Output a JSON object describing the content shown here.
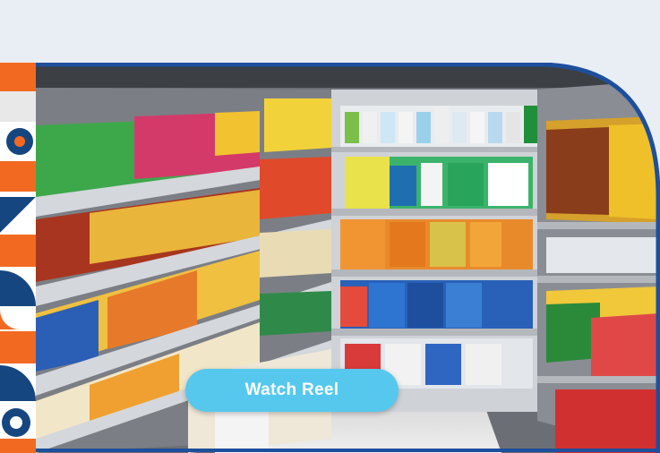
{
  "hero": {
    "image_subject": "grocery-shelves-photo",
    "cta_label": "Watch Reel"
  },
  "colors": {
    "page_bg": "#e9eef5",
    "frame_border": "#1d4f9c",
    "accent_orange": "#f26a21",
    "accent_navy": "#16467f",
    "button_bg": "#56c8ee",
    "button_text": "#ffffff"
  }
}
